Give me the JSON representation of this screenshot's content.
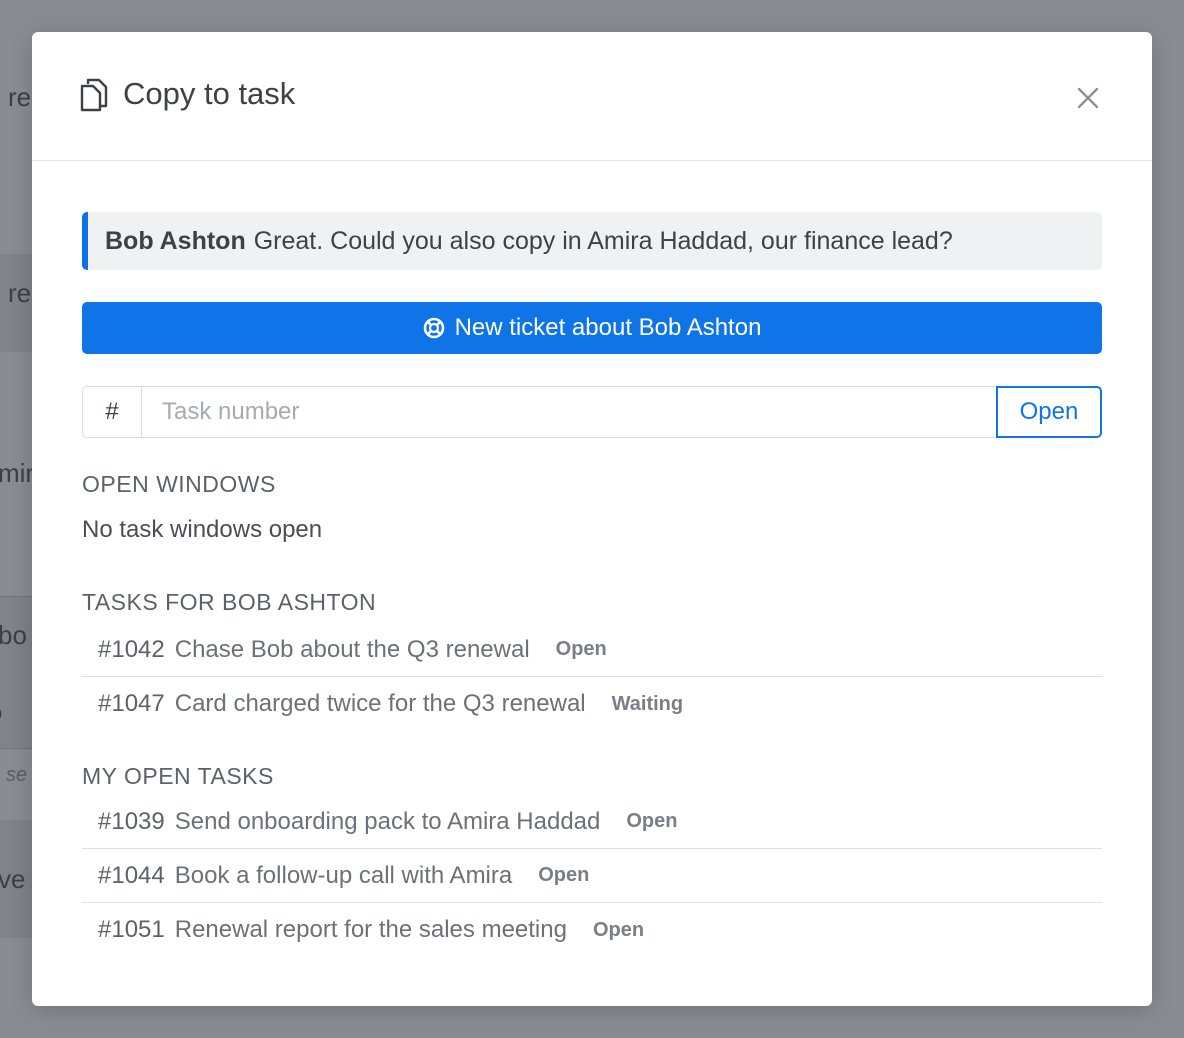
{
  "background": {
    "fragments": [
      "re",
      "re",
      "mir",
      "bo",
      "o",
      "se",
      "ve"
    ]
  },
  "modal": {
    "title": "Copy to task",
    "title_icon": "documents-icon",
    "close_icon": "close-icon"
  },
  "quote": {
    "author": "Bob Ashton",
    "text": "Great. Could you also copy in Amira Haddad, our finance lead?"
  },
  "new_ticket": {
    "label": "New ticket about Bob Ashton",
    "icon": "lifebuoy-icon"
  },
  "task_lookup": {
    "prefix": "#",
    "placeholder": "Task number",
    "value": "",
    "open_label": "Open"
  },
  "open_windows": {
    "heading": "OPEN WINDOWS",
    "empty_text": "No task windows open"
  },
  "contact_tasks": {
    "heading": "TASKS FOR BOB ASHTON",
    "items": [
      {
        "number": "#1042",
        "title": "Chase Bob about the Q3 renewal",
        "status": "Open"
      },
      {
        "number": "#1047",
        "title": "Card charged twice for the Q3 renewal",
        "status": "Waiting"
      }
    ]
  },
  "my_tasks": {
    "heading": "MY OPEN TASKS",
    "items": [
      {
        "number": "#1039",
        "title": "Send onboarding pack to Amira Haddad",
        "status": "Open"
      },
      {
        "number": "#1044",
        "title": "Book a follow-up call with Amira",
        "status": "Open"
      },
      {
        "number": "#1051",
        "title": "Renewal report for the sales meeting",
        "status": "Open"
      }
    ]
  },
  "colors": {
    "accent": "#0e74e8",
    "quote_border": "#0b71e6",
    "overlay": "#8a8e96"
  }
}
